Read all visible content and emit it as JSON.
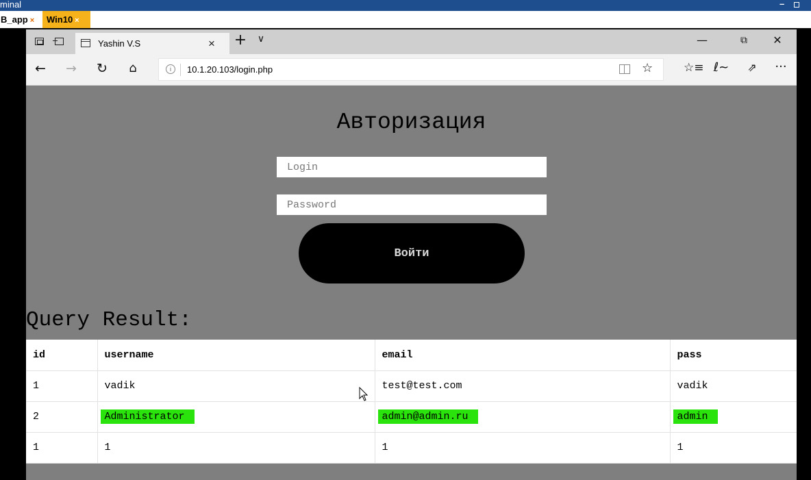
{
  "terminal": {
    "title": "minal",
    "tabs": [
      {
        "label": "B_app",
        "close": "×"
      },
      {
        "label": "Win10",
        "close": "×"
      }
    ]
  },
  "browser": {
    "tab_title": "Yashin V.S",
    "tab_close": "×",
    "new_tab": "+",
    "tab_dropdown": "∨",
    "win_min": "—",
    "win_restore": "⧉",
    "win_close": "✕",
    "url": "10.1.20.103/login.php",
    "icons": {
      "back": "←",
      "forward": "→",
      "refresh": "↻",
      "home": "⌂",
      "info": "i",
      "favorite": "☆",
      "favorites": "☆≡",
      "notes": "ℓ~",
      "share": "⇗",
      "more": "···"
    }
  },
  "page": {
    "auth_title": "Авторизация",
    "login_placeholder": "Login",
    "password_placeholder": "Password",
    "login_button": "Войти",
    "query_title": "Query Result:",
    "table": {
      "headers": [
        "id",
        "username",
        "email",
        "pass"
      ],
      "rows": [
        [
          "1",
          "vadik",
          "test@test.com",
          "vadik"
        ],
        [
          "2",
          "Administrator",
          "admin@admin.ru",
          "admin"
        ],
        [
          "1",
          "1",
          "1",
          "1"
        ]
      ]
    }
  },
  "colors": {
    "terminal_titlebar": "#1f4e8f",
    "active_tab": "#f6b21b",
    "page_background": "#7f7f7f",
    "highlight": "#2ae30c",
    "button": "#000000"
  }
}
